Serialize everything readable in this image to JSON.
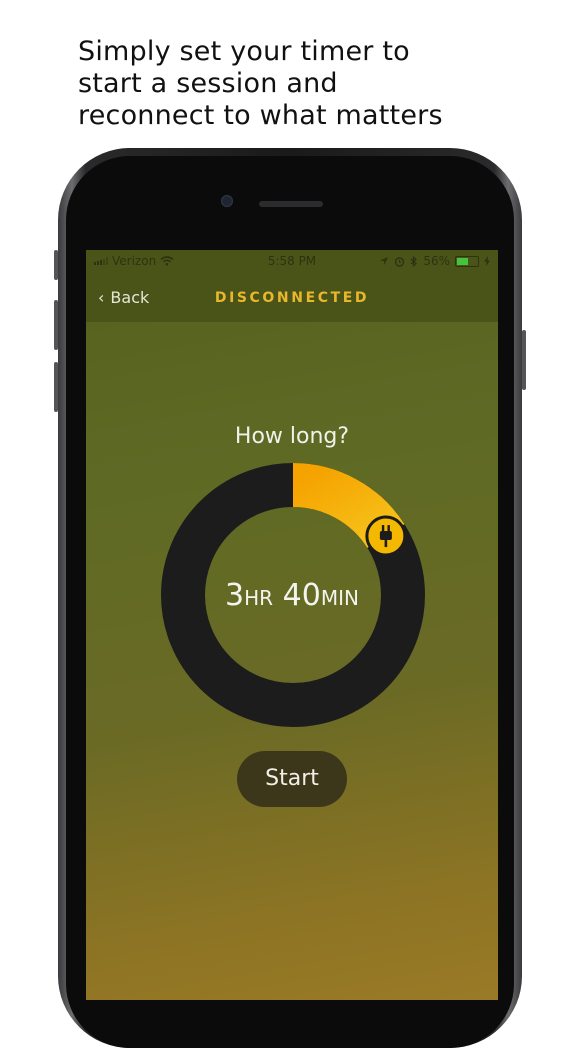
{
  "headline": {
    "line1": "Simply set your timer to",
    "line2": "start a session and",
    "line3": "reconnect to what matters"
  },
  "status_bar": {
    "carrier": "Verizon",
    "time": "5:58 PM",
    "battery_percent": "56%",
    "battery_level": 0.56
  },
  "nav": {
    "back_label": "Back",
    "title": "DISCONNECTED"
  },
  "timer": {
    "question": "How long?",
    "hours": "3",
    "hours_unit": "HR",
    "minutes": "40",
    "minutes_unit": "MIN",
    "dial_fraction": 0.16,
    "handle_icon": "plug-icon"
  },
  "start_button": {
    "label": "Start"
  },
  "colors": {
    "accent": "#f5b800",
    "nav_title": "#e9b82a",
    "track": "#1c1c1c",
    "background_top": "#56601f",
    "background_bottom": "#9a7a26"
  }
}
